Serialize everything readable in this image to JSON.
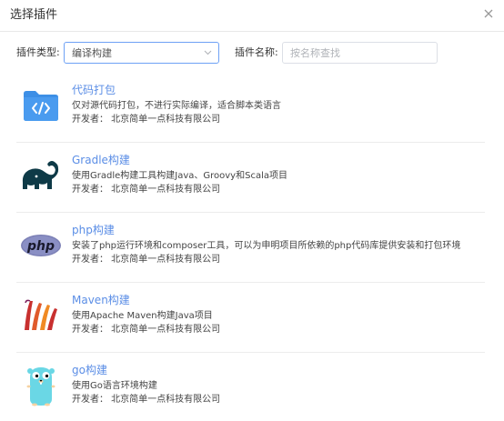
{
  "dialog": {
    "title": "选择插件",
    "close_icon": "close-icon"
  },
  "filters": {
    "type_label": "插件类型:",
    "type_value": "编译构建",
    "name_label": "插件名称:",
    "name_placeholder": "按名称查找",
    "name_value": ""
  },
  "plugins": [
    {
      "name": "代码打包",
      "desc": "仅对源代码打包，不进行实际编译，适合脚本类语言",
      "developer": "开发者： 北京简单一点科技有限公司",
      "icon": "code-folder-icon"
    },
    {
      "name": "Gradle构建",
      "desc": "使用Gradle构建工具构建Java、Groovy和Scala项目",
      "developer": "开发者： 北京简单一点科技有限公司",
      "icon": "gradle-elephant-icon"
    },
    {
      "name": "php构建",
      "desc": "安装了php运行环境和composer工具，可以为申明项目所依赖的php代码库提供安装和打包环境",
      "developer": "开发者： 北京简单一点科技有限公司",
      "icon": "php-logo-icon"
    },
    {
      "name": "Maven构建",
      "desc": "使用Apache Maven构建Java项目",
      "developer": "开发者： 北京简单一点科技有限公司",
      "icon": "maven-feather-icon"
    },
    {
      "name": "go构建",
      "desc": "使用Go语言环境构建",
      "developer": "开发者： 北京简单一点科技有限公司",
      "icon": "go-gopher-icon"
    }
  ],
  "colors": {
    "accent": "#5b8ee6",
    "select_border": "#6ea1f5"
  }
}
